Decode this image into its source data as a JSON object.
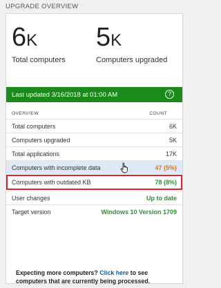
{
  "header": {
    "title": "UPGRADE OVERVIEW"
  },
  "stats": [
    {
      "value": "6",
      "unit": "K",
      "label": "Total computers"
    },
    {
      "value": "5",
      "unit": "K",
      "label": "Computers upgraded"
    }
  ],
  "banner": {
    "text": "Last updated 3/16/2018 at 01:00 AM",
    "help_icon": "?",
    "color": "#1a8b1a"
  },
  "table": {
    "columns": [
      "OVERVIEW",
      "COUNT"
    ],
    "rows": [
      {
        "label": "Total computers",
        "value": "6K"
      },
      {
        "label": "Computers upgraded",
        "value": "5K"
      },
      {
        "label": "Total applications",
        "value": "17K"
      },
      {
        "label": "Computers with incomplete data",
        "value": "47 (5%)"
      },
      {
        "label": "Computers with outdated KB",
        "value": "78 (8%)"
      },
      {
        "label": "User changes",
        "value": "Up to date"
      },
      {
        "label": "Target version",
        "value": "Windows 10 Version 1709"
      }
    ]
  },
  "footer": {
    "prefix": "Expecting more computers?",
    "link": "Click here",
    "suffix": "to see computers that are currently being processed."
  },
  "colors": {
    "accent_green": "#1a8b1a",
    "warning_orange": "#d47a22",
    "ok_green": "#2a9230",
    "highlight_red": "#d9232d"
  }
}
